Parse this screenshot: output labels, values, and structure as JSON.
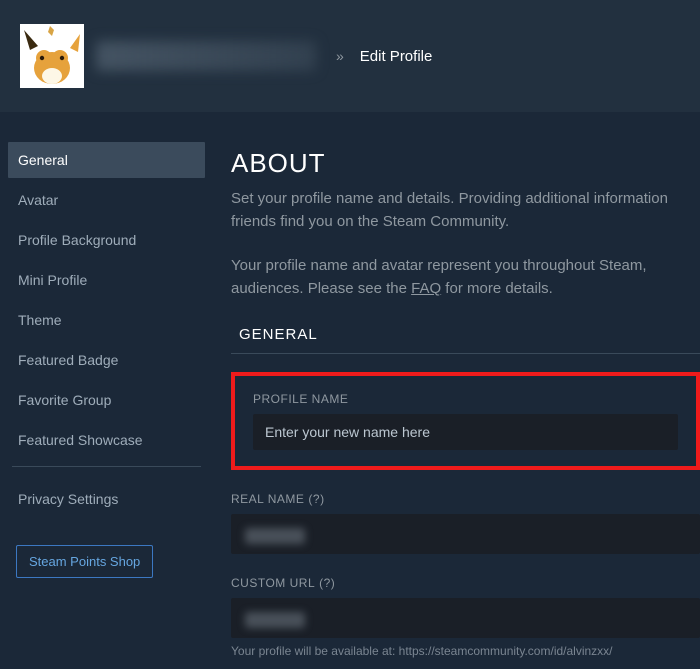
{
  "breadcrumb": {
    "separator": "»",
    "current": "Edit Profile"
  },
  "sidebar": {
    "items": [
      {
        "label": "General",
        "active": true
      },
      {
        "label": "Avatar",
        "active": false
      },
      {
        "label": "Profile Background",
        "active": false
      },
      {
        "label": "Mini Profile",
        "active": false
      },
      {
        "label": "Theme",
        "active": false
      },
      {
        "label": "Featured Badge",
        "active": false
      },
      {
        "label": "Favorite Group",
        "active": false
      },
      {
        "label": "Featured Showcase",
        "active": false
      }
    ],
    "privacy_label": "Privacy Settings",
    "points_shop_label": "Steam Points Shop"
  },
  "about": {
    "heading": "ABOUT",
    "para1": "Set your profile name and details. Providing additional information friends find you on the Steam Community.",
    "para2_a": "Your profile name and avatar represent you throughout Steam, audiences. Please see the ",
    "faq_text": "FAQ",
    "para2_b": " for more details."
  },
  "general": {
    "section_title": "GENERAL",
    "profile_name_label": "PROFILE NAME",
    "profile_name_value": "Enter your new name here",
    "real_name_label": "REAL NAME",
    "help_marker": "(?)",
    "custom_url_label": "CUSTOM URL",
    "url_hint_prefix": "Your profile will be available at: ",
    "url_hint_value": "https://steamcommunity.com/id/alvinzxx/"
  }
}
